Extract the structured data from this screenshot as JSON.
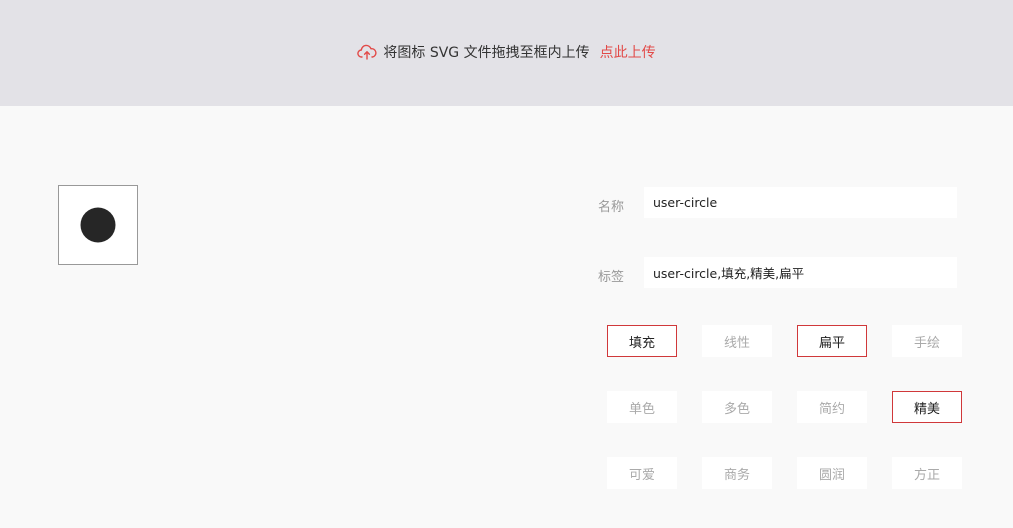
{
  "upload": {
    "icon": "cloud-upload-icon",
    "text": "将图标 SVG 文件拖拽至框内上传",
    "link": "点此上传",
    "accent_color": "#e24a48"
  },
  "preview": {
    "icon": "user-circle-icon"
  },
  "form": {
    "name_label": "名称",
    "name_value": "user-circle",
    "tags_label": "标签",
    "tags_value": "user-circle,填充,精美,扁平"
  },
  "tags": [
    {
      "label": "填充",
      "active": true
    },
    {
      "label": "线性",
      "active": false
    },
    {
      "label": "扁平",
      "active": true
    },
    {
      "label": "手绘",
      "active": false
    },
    {
      "label": "单色",
      "active": false
    },
    {
      "label": "多色",
      "active": false
    },
    {
      "label": "简约",
      "active": false
    },
    {
      "label": "精美",
      "active": true
    },
    {
      "label": "可爱",
      "active": false
    },
    {
      "label": "商务",
      "active": false
    },
    {
      "label": "圆润",
      "active": false
    },
    {
      "label": "方正",
      "active": false
    }
  ]
}
